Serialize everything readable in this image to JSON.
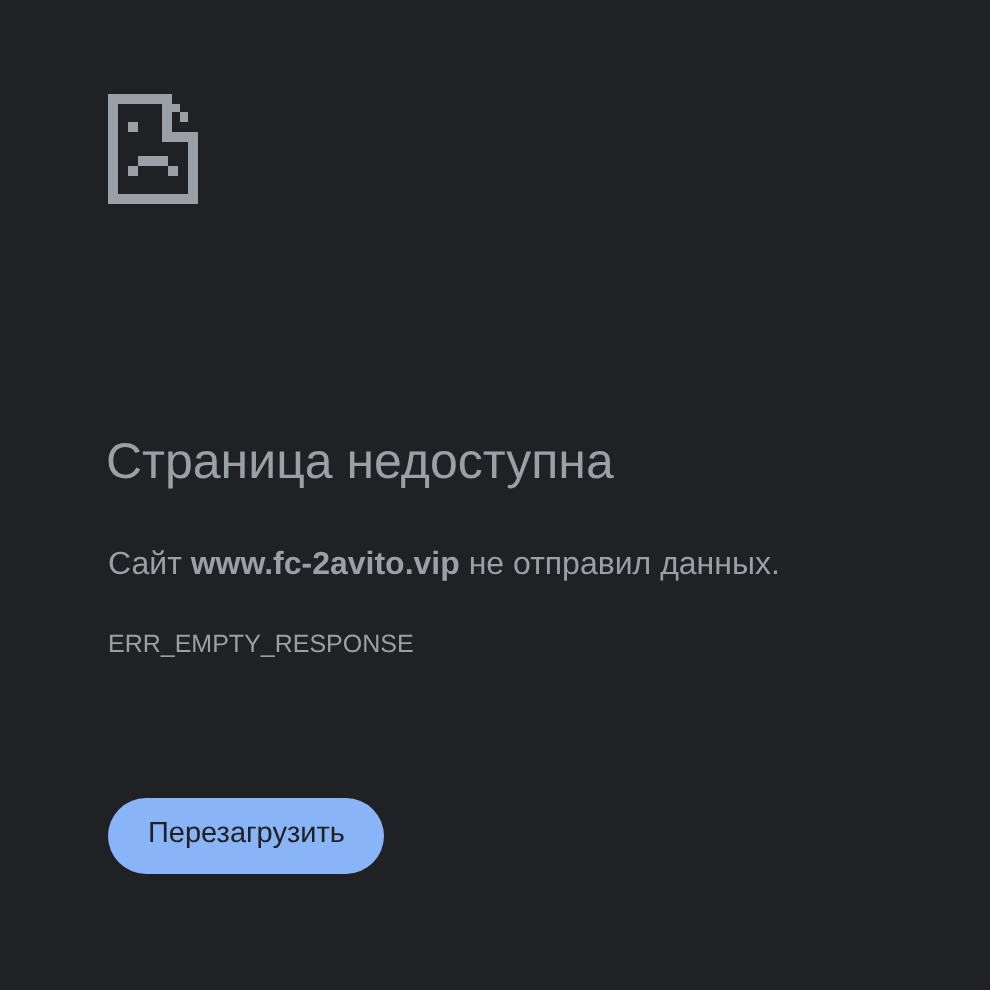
{
  "title": "Страница недоступна",
  "message": "Сайт **www.fc-2avito.vip** не отправил данных.",
  "error_code": "ERR_EMPTY_RESPONSE",
  "buttons": [
    {
      "label": "Перезагрузить"
    }
  ]
}
